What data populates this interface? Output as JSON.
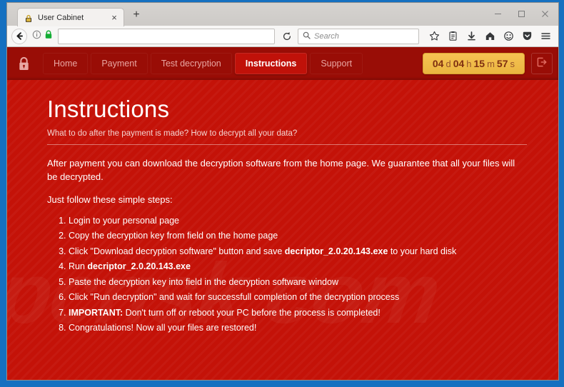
{
  "browser": {
    "tab": {
      "title": "User Cabinet",
      "favicon": "lock-favicon",
      "close_label": "×"
    },
    "newtab_label": "+",
    "window_controls": {
      "minimize": "minimize-icon",
      "maximize": "maximize-icon",
      "close": "close-icon"
    },
    "toolbar": {
      "back": "back-arrow-icon",
      "site_info": "info-icon",
      "padlock": "secure-lock-icon",
      "url_value": "",
      "url_placeholder": "",
      "reload": "reload-icon",
      "search_placeholder": "Search",
      "search_value": "",
      "icons": [
        {
          "name": "bookmark-star-icon",
          "glyph": "☆"
        },
        {
          "name": "library-icon",
          "glyph": "🗊"
        },
        {
          "name": "download-icon",
          "glyph": "↓"
        },
        {
          "name": "home-icon",
          "glyph": "⌂"
        },
        {
          "name": "account-icon",
          "glyph": "☺"
        },
        {
          "name": "pocket-icon",
          "glyph": "▼"
        },
        {
          "name": "menu-icon",
          "glyph": "☰"
        }
      ]
    }
  },
  "site": {
    "brand_icon": "padlock-icon",
    "nav": [
      {
        "label": "Home",
        "active": false
      },
      {
        "label": "Payment",
        "active": false
      },
      {
        "label": "Test decryption",
        "active": false
      },
      {
        "label": "Instructions",
        "active": true
      },
      {
        "label": "Support",
        "active": false
      }
    ],
    "timer": {
      "days": "04",
      "days_unit": "d",
      "hours": "04",
      "hours_unit": "h",
      "minutes": "15",
      "minutes_unit": "m",
      "seconds": "57",
      "seconds_unit": "s"
    },
    "logout_icon": "logout-icon",
    "watermark": "pcrisk.com",
    "content": {
      "title": "Instructions",
      "subtitle": "What to do after the payment is made? How to decrypt all your data?",
      "lead": "After payment you can download the decryption software from the home page. We guarantee that all your files will be decrypted.",
      "lead2": "Just follow these simple steps:",
      "steps": [
        {
          "pre": "Login to your personal page",
          "bold": "",
          "post": ""
        },
        {
          "pre": "Copy the decryption key from field on the home page",
          "bold": "",
          "post": ""
        },
        {
          "pre": "Click \"Download decryption software\" button and save ",
          "bold": "decriptor_2.0.20.143.exe",
          "post": " to your hard disk"
        },
        {
          "pre": "Run ",
          "bold": "decriptor_2.0.20.143.exe",
          "post": ""
        },
        {
          "pre": "Paste the decryption key into field in the decryption software window",
          "bold": "",
          "post": ""
        },
        {
          "pre": "Click \"Run decryption\" and wait for successfull completion of the decryption process",
          "bold": "",
          "post": ""
        },
        {
          "pre": "",
          "bold": "IMPORTANT:",
          "post": " Don't turn off or reboot your PC before the process is completed!"
        },
        {
          "pre": "Congratulations! Now all your files are restored!",
          "bold": "",
          "post": ""
        }
      ]
    }
  },
  "colors": {
    "page_red": "#c41208",
    "header_red": "#990d06",
    "active_nav": "#c01109",
    "timer_gold": "#efbb4a",
    "desktop_blue": "#1570c0"
  }
}
